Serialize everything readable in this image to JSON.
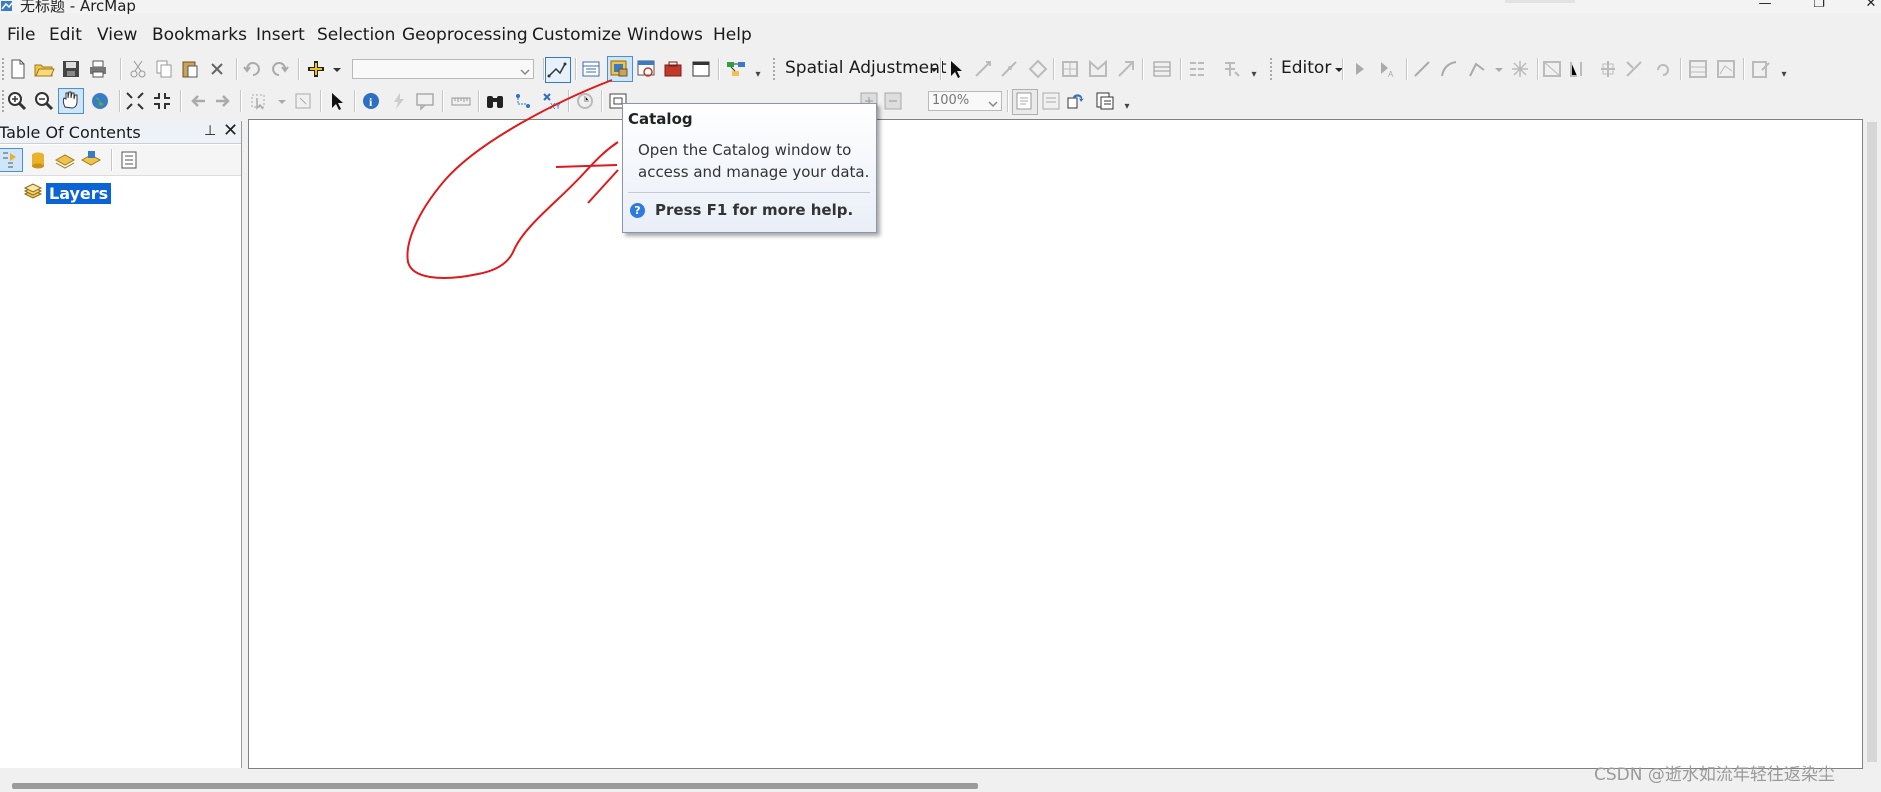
{
  "window": {
    "title": "无标题 - ArcMap",
    "controls": [
      "—",
      "❐",
      "✕"
    ]
  },
  "menu": [
    "File",
    "Edit",
    "View",
    "Bookmarks",
    "Insert",
    "Selection",
    "Geoprocessing",
    "Customize",
    "Windows",
    "Help"
  ],
  "toolbar1": {
    "spatial_adjustment_label": "Spatial Adjustment",
    "editor_label": "Editor",
    "pressed_tool": "catalog-button"
  },
  "toolbar2": {
    "zoom_value": "100%"
  },
  "toc": {
    "title": "Table Of Contents",
    "pin_glyph": "⊥",
    "close_glyph": "✕",
    "layers_label": "Layers"
  },
  "tooltip": {
    "title": "Catalog",
    "body_lines": [
      "Open the Catalog window to",
      "access and manage your data."
    ],
    "help_text": "Press F1 for more help."
  },
  "icons": {
    "annotation_color": "#e0191b",
    "selection_color": "#0a64d6"
  },
  "watermark": "CSDN @逝水如流年轻往返染尘"
}
